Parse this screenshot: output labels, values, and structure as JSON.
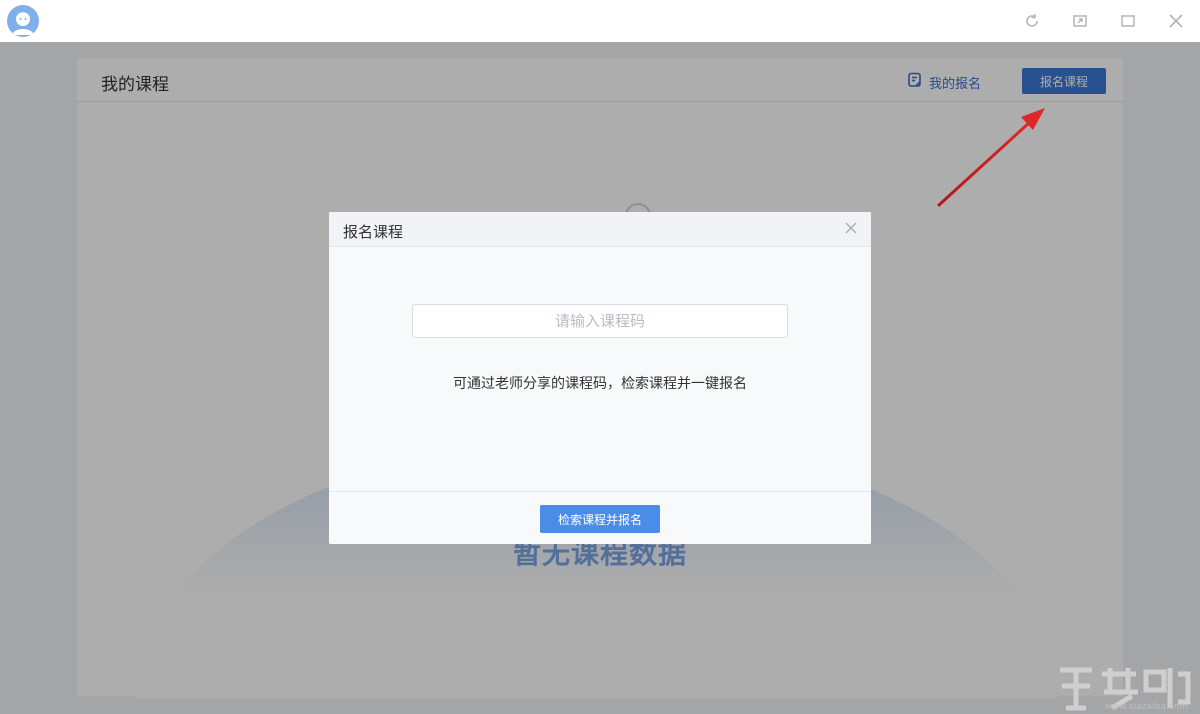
{
  "window": {
    "icons": [
      "avatar-icon",
      "refresh-icon",
      "restore-icon",
      "maximize-icon",
      "close-icon"
    ]
  },
  "panel": {
    "title": "我的课程",
    "my_registrations_label": "我的报名",
    "register_button_label": "报名课程",
    "empty_state_text": "暂无课程数据"
  },
  "modal": {
    "title": "报名课程",
    "input_placeholder": "请输入课程码",
    "input_value": "",
    "hint": "可通过老师分享的课程码，检索课程并一键报名",
    "search_button_label": "检索课程并报名"
  },
  "watermark": {
    "url": "www.xiazaiba.com"
  },
  "colors": {
    "accent": "#3b78d8",
    "button_blue": "#4b8ce8",
    "link_blue": "#3a6fc8",
    "annotation_arrow": "#d42020"
  }
}
